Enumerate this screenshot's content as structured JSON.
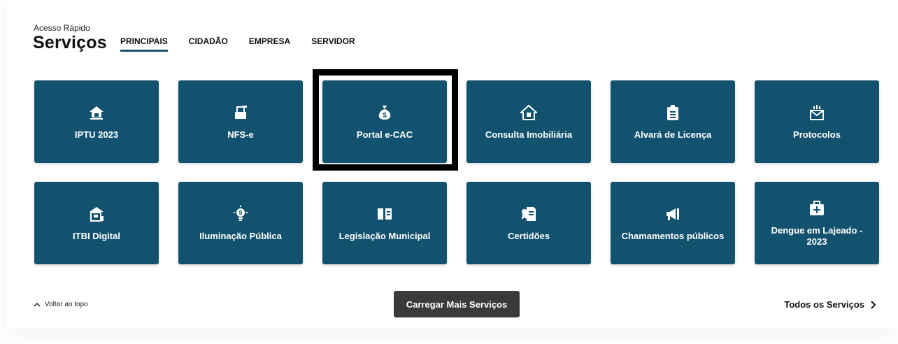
{
  "header": {
    "kicker": "Acesso Rápido",
    "title": "Serviços",
    "tabs": [
      {
        "label": "PRINCIPAIS",
        "active": true
      },
      {
        "label": "CIDADÃO",
        "active": false
      },
      {
        "label": "EMPRESA",
        "active": false
      },
      {
        "label": "SERVIDOR",
        "active": false
      }
    ]
  },
  "services": [
    {
      "label": "IPTU 2023",
      "icon": "house-tax-icon"
    },
    {
      "label": "NFS-e",
      "icon": "invoice-machine-icon"
    },
    {
      "label": "Portal e-CAC",
      "icon": "money-bag-icon"
    },
    {
      "label": "Consulta Imobiliária",
      "icon": "house-icon"
    },
    {
      "label": "Alvará de Licença",
      "icon": "clipboard-icon"
    },
    {
      "label": "Protocolos",
      "icon": "envelope-icon"
    },
    {
      "label": "ITBI Digital",
      "icon": "building-icon"
    },
    {
      "label": "Iluminação Pública",
      "icon": "lightbulb-icon"
    },
    {
      "label": "Legislação Municipal",
      "icon": "book-icon"
    },
    {
      "label": "Certidões",
      "icon": "certificate-icon"
    },
    {
      "label": "Chamamentos públicos",
      "icon": "megaphone-icon"
    },
    {
      "label": "Dengue em Lajeado - 2023",
      "icon": "first-aid-icon"
    }
  ],
  "footer": {
    "back_to_top": "Voltar ao topo",
    "load_more": "Carregar Mais Serviços",
    "all_services": "Todos os Serviços"
  },
  "colors": {
    "card": "#12526f",
    "button": "#3a3a3a"
  }
}
